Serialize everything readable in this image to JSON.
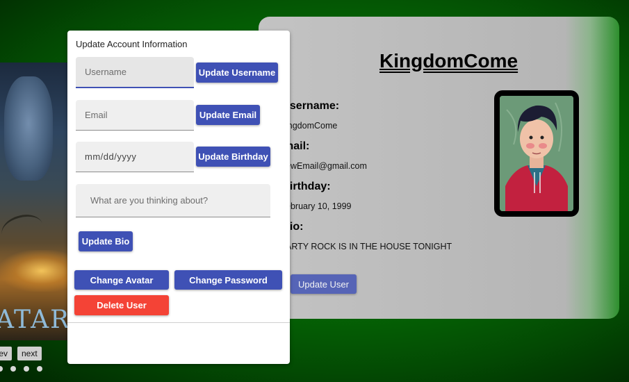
{
  "carousel": {
    "poster_title": "ATAR",
    "prev_label": "ev",
    "next_label": "next",
    "dot_count": 4
  },
  "profile": {
    "display_name": "KingdomCome",
    "username_label": "Jsername:",
    "username_value": "ingdomCome",
    "email_label": "mail:",
    "email_value": "ewEmail@gmail.com",
    "birthday_label": "3irthday:",
    "birthday_value": "ebruary 10, 1999",
    "bio_label": "3io:",
    "bio_value": "ARTY ROCK IS IN THE HOUSE TONIGHT",
    "update_user_label": "Update User",
    "avatar_icon": "user-avatar-illustration"
  },
  "edit_form": {
    "heading": "Update Account Information",
    "username_placeholder": "Username",
    "update_username_label": "Update Username",
    "email_placeholder": "Email",
    "update_email_label": "Update Email",
    "birthday_placeholder": "mm/dd/yyyy",
    "update_birthday_label": "Update Birthday",
    "bio_placeholder": "What are you thinking about?",
    "update_bio_label": "Update Bio",
    "change_avatar_label": "Change Avatar",
    "change_password_label": "Change Password",
    "delete_user_label": "Delete User"
  },
  "colors": {
    "primary": "#3f51b5",
    "danger": "#f44336",
    "background_green": "#067006"
  }
}
